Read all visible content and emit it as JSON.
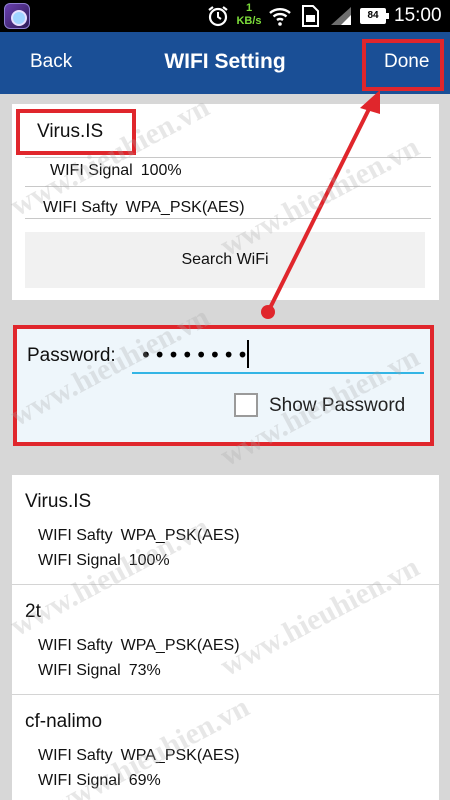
{
  "status_bar": {
    "speed_value": "1",
    "speed_unit": "KB/s",
    "battery": "84",
    "time": "15:00"
  },
  "header": {
    "back_label": "Back",
    "title": "WIFI Setting",
    "done_label": "Done"
  },
  "current": {
    "ssid": "Virus.IS",
    "signal_label": "WIFI Signal",
    "signal_value": "100%",
    "safety_label": "WIFI Safty",
    "safety_value": "WPA_PSK(AES)",
    "search_label": "Search WiFi"
  },
  "password": {
    "label": "Password:",
    "value": "••••••••",
    "show_label": "Show Password"
  },
  "networks": [
    {
      "name": "Virus.IS",
      "safety_label": "WIFI Safty",
      "safety": "WPA_PSK(AES)",
      "signal_label": "WIFI Signal",
      "signal": "100%"
    },
    {
      "name": "2t",
      "safety_label": "WIFI Safty",
      "safety": "WPA_PSK(AES)",
      "signal_label": "WIFI Signal",
      "signal": "73%"
    },
    {
      "name": "cf-nalimo",
      "safety_label": "WIFI Safty",
      "safety": "WPA_PSK(AES)",
      "signal_label": "WIFI Signal",
      "signal": "69%"
    }
  ],
  "watermark": "www.hieuhien.vn",
  "colors": {
    "header_bg": "#1a4f96",
    "highlight": "#e0262c",
    "input_underline": "#33b5e5"
  },
  "icons": [
    "alarm-icon",
    "wifi-icon",
    "sim-icon",
    "signal-icon",
    "battery-icon"
  ]
}
